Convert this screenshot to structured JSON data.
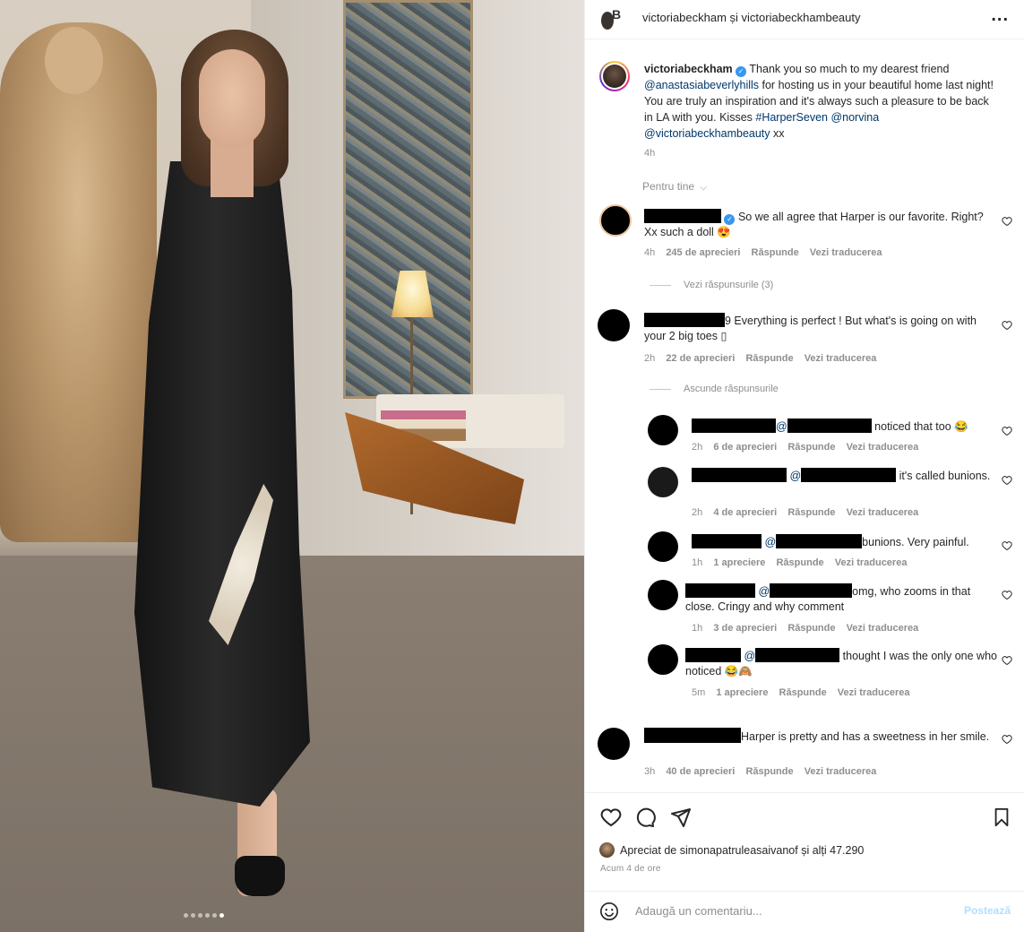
{
  "post": {
    "header_names": "victoriabeckham și victoriabeckhambeauty",
    "more_label": "...",
    "caption_user": "victoriabeckham",
    "caption_parts": [
      " Thank you so much to my dearest friend ",
      "@anastasiabeverlyhills",
      " for hosting us in your beautiful home last night! You are truly an inspiration and it's always such a pleasure to be back in LA with you. Kisses ",
      "#HarperSeven",
      " ",
      "@norvina",
      " ",
      "@victoriabeckhambeauty",
      " xx"
    ],
    "caption_time": "4h",
    "sort_label": "Pentru tine",
    "image_dots": {
      "count": 6,
      "active_index": 5
    }
  },
  "comments": [
    {
      "text": " So we all agree that Harper is our favorite. Right? Xx such a doll 😍",
      "time": "4h",
      "likes": "245 de aprecieri",
      "reply": "Răspunde",
      "translate": "Vezi traducerea",
      "toggle": "Vezi răspunsurile (3)"
    },
    {
      "text": "9 Everything is perfect ! But what's is going on with your 2 big toes ▯",
      "time": "2h",
      "likes": "22 de aprecieri",
      "reply": "Răspunde",
      "translate": "Vezi traducerea",
      "toggle": "Ascunde răspunsurile",
      "replies": [
        {
          "mention": "@",
          "text": " noticed that too 😂",
          "time": "2h",
          "likes": "6 de aprecieri",
          "reply": "Răspunde",
          "translate": "Vezi traducerea"
        },
        {
          "mention": " @",
          "text": " it's called bunions.",
          "time": "2h",
          "likes": "4 de aprecieri",
          "reply": "Răspunde",
          "translate": "Vezi traducerea"
        },
        {
          "mention": " @",
          "text": "bunions. Very painful.",
          "time": "1h",
          "likes": "1 apreciere",
          "reply": "Răspunde",
          "translate": "Vezi traducerea"
        },
        {
          "mention": " @",
          "text": "omg, who zooms in that close. Cringy and why comment",
          "time": "1h",
          "likes": "3 de aprecieri",
          "reply": "Răspunde",
          "translate": "Vezi traducerea"
        },
        {
          "mention": " @",
          "text": " thought I was the only one who noticed 😂🙈",
          "time": "5m",
          "likes": "1 apreciere",
          "reply": "Răspunde",
          "translate": "Vezi traducerea"
        }
      ]
    },
    {
      "text": "Harper is pretty and has a sweetness in her smile.",
      "time": "3h",
      "likes": "40 de aprecieri",
      "reply": "Răspunde",
      "translate": "Vezi traducerea"
    }
  ],
  "footer": {
    "liked_by": "Apreciat de simonapatruleasaivanof și alți 47.290",
    "posted_ago": "Acum 4 de ore",
    "comment_placeholder": "Adaugă un comentariu...",
    "post_button": "Postează"
  },
  "icons": [
    "heart-icon",
    "comment-icon",
    "share-icon",
    "bookmark-icon",
    "emoji-icon",
    "verified-badge-icon",
    "chevron-down-icon",
    "more-icon"
  ],
  "colors": {
    "link": "#00376b",
    "verified": "#3897f0",
    "muted": "#8e8e8e",
    "post_disabled": "#b2dffc"
  }
}
